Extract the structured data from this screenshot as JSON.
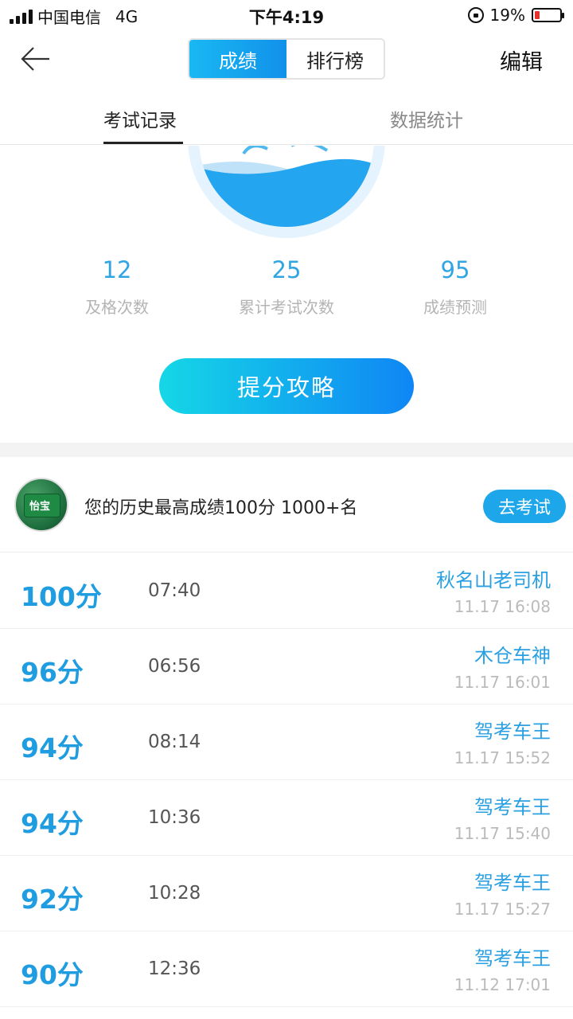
{
  "status_bar": {
    "carrier": "中国电信",
    "network": "4G",
    "time": "下午4:19",
    "battery_percent": "19%",
    "battery_level": 0.19,
    "battery_color": "#e5322d"
  },
  "header": {
    "segments": [
      {
        "label": "成绩",
        "active": true
      },
      {
        "label": "排行榜",
        "active": false
      }
    ],
    "edit_label": "编辑",
    "back_icon": "arrow-left-icon"
  },
  "tabs": [
    {
      "label": "考试记录",
      "active": true
    },
    {
      "label": "数据统计",
      "active": false
    }
  ],
  "stats": [
    {
      "value": "12",
      "label": "及格次数"
    },
    {
      "value": "25",
      "label": "累计考试次数"
    },
    {
      "value": "95",
      "label": "成绩预测"
    }
  ],
  "cta_label": "提分攻略",
  "best": {
    "text": "您的历史最高成绩100分 1000+名",
    "button_label": "去考试",
    "avatar_text": "怡宝"
  },
  "records": [
    {
      "score": "100分",
      "duration": "07:40",
      "user": "秋名山老司机",
      "time": "11.17 16:08"
    },
    {
      "score": "96分",
      "duration": "06:56",
      "user": "木仓车神",
      "time": "11.17 16:01"
    },
    {
      "score": "94分",
      "duration": "08:14",
      "user": "驾考车王",
      "time": "11.17 15:52"
    },
    {
      "score": "94分",
      "duration": "10:36",
      "user": "驾考车王",
      "time": "11.17 15:40"
    },
    {
      "score": "92分",
      "duration": "10:28",
      "user": "驾考车王",
      "time": "11.17 15:27"
    },
    {
      "score": "90分",
      "duration": "12:36",
      "user": "驾考车王",
      "time": "11.12 17:01"
    }
  ],
  "colors": {
    "accent": "#1f9de0",
    "cta_start": "#15d7e6",
    "cta_end": "#0f86f5",
    "muted": "#b4b4b4"
  }
}
